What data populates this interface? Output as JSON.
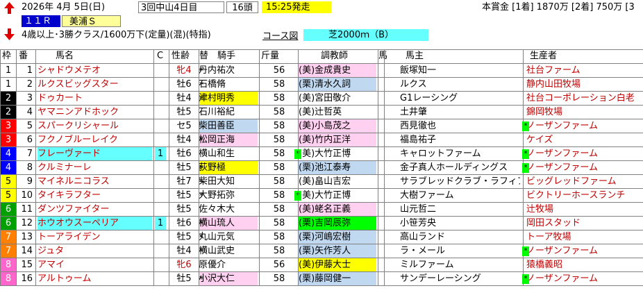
{
  "header": {
    "date_text": "2026年  4月  5日(日)",
    "meeting": "3回中山4日目",
    "runners": "16頭",
    "post_time": "15:25発走",
    "prize": "本賞金 [1着] 1870万 [2着] 750万 [3",
    "race_number": "１１Ｒ",
    "race_name": "美浦Ｓ",
    "conditions": "4歳以上･3勝クラス/1600万下(定量)(混)(特指)",
    "course_label": "コース図",
    "course": "芝2000ｍ（B）"
  },
  "columns": [
    "枠",
    "番",
    "馬名",
    "C",
    "性齢",
    "替",
    "騎手",
    "斤量",
    "調教師",
    "馬",
    "馬主",
    "生産者"
  ],
  "colors": {
    "waku": [
      "#ffffff",
      "#000000",
      "#ff0000",
      "#0000ff",
      "#ffff00",
      "#00a000",
      "#ff8000",
      "#ff66cc"
    ],
    "waku_text": [
      "#000000",
      "#ffffff",
      "#ffffff",
      "#ffffff",
      "#000000",
      "#ffffff",
      "#ffffff",
      "#ffffff"
    ],
    "highlight_pink": "#ffd0f0",
    "highlight_yellow": "#ffff00",
    "highlight_cyan": "#66ffff",
    "highlight_green": "#00ff00",
    "highlight_blue": "#c0d8f0",
    "name_color": "#c00000"
  },
  "rows": [
    {
      "waku": "1",
      "num": "1",
      "name": "シャドウメテオ",
      "c": "",
      "sex": "牝4",
      "sex_red": true,
      "sw": "*",
      "jockey": "丹内祐次",
      "jbg": "",
      "wt": "56",
      "tmark": "",
      "trainer": "(美)金成貴史",
      "tbg": "pink",
      "owner": "飯塚知一",
      "bmark": "",
      "breeder": "社台ファーム"
    },
    {
      "waku": "1",
      "num": "2",
      "name": "ルクスビッグスター",
      "c": "",
      "sex": "牡6",
      "sex_red": false,
      "sw": "*",
      "jockey": "石橋脩",
      "jbg": "",
      "wt": "58",
      "tmark": "",
      "trainer": "(栗)清水久詞",
      "tbg": "blue",
      "owner": "ルクス",
      "bmark": "",
      "breeder": "静内山田牧場"
    },
    {
      "waku": "2",
      "num": "3",
      "name": "ドゥカート",
      "c": "",
      "sex": "牡4",
      "sex_red": false,
      "sw": "*",
      "jockey": "津村明秀",
      "jbg": "yellow",
      "wt": "58",
      "tmark": "",
      "trainer": "(美)宮田敬介",
      "tbg": "",
      "owner": "G1レーシング",
      "bmark": "",
      "breeder": "社台コーポレーション白老"
    },
    {
      "waku": "2",
      "num": "4",
      "name": "ヤマニンアドホック",
      "c": "",
      "sex": "牡5",
      "sex_red": false,
      "sw": "",
      "jockey": "石川裕紀",
      "jbg": "",
      "wt": "58",
      "tmark": "",
      "trainer": "(美)辻哲英",
      "tbg": "",
      "owner": "土井肇",
      "bmark": "",
      "breeder": "錦岡牧場"
    },
    {
      "waku": "3",
      "num": "5",
      "name": "スパークリシャール",
      "c": "",
      "sex": "セ5",
      "sex_red": false,
      "sw": "",
      "jockey": "柴田善臣",
      "jbg": "blue",
      "wt": "58",
      "tmark": "",
      "trainer": "(美)小島茂之",
      "tbg": "pink",
      "owner": "西見徹也",
      "bmark": "*",
      "breeder": "ノーザンファーム"
    },
    {
      "waku": "3",
      "num": "6",
      "name": "フクノブルーレイク",
      "c": "",
      "sex": "牡4",
      "sex_red": false,
      "sw": "*",
      "jockey": "松岡正海",
      "jbg": "pink",
      "wt": "58",
      "tmark": "",
      "trainer": "(美)竹内正洋",
      "tbg": "pink",
      "owner": "福島祐子",
      "bmark": "",
      "breeder": "ケイズ"
    },
    {
      "waku": "4",
      "num": "7",
      "name": "フレーヴァード",
      "c": "1",
      "c_bg": "cyan",
      "name_bg": "cyan",
      "sex": "牡6",
      "sex_red": false,
      "sw": "",
      "jockey": "横山和生",
      "jbg": "",
      "wt": "58",
      "tmark": "*",
      "trainer": "(美)大竹正博",
      "tbg": "",
      "owner": "キャロットファーム",
      "bmark": "*",
      "breeder": "ノーザンファーム"
    },
    {
      "waku": "4",
      "num": "8",
      "name": "クルミナーレ",
      "c": "",
      "sex": "牡5",
      "sex_red": false,
      "sw": "*",
      "jockey": "荻野極",
      "jbg": "yellow",
      "wt": "58",
      "tmark": "",
      "trainer": "(栗)池江泰寿",
      "tbg": "blue",
      "owner": "金子真人ホールディングス",
      "bmark": "*",
      "breeder": "ノーザンファーム"
    },
    {
      "waku": "5",
      "num": "9",
      "name": "マイネルニコラス",
      "c": "",
      "sex": "牡7",
      "sex_red": false,
      "sw": "*",
      "jockey": "柴田大知",
      "jbg": "",
      "wt": "58",
      "tmark": "",
      "trainer": "(美)畠山吉宏",
      "tbg": "",
      "owner": "サラブレッドクラブ・ラフィアン",
      "bmark": "",
      "breeder": "ビッグレッドファーム"
    },
    {
      "waku": "5",
      "num": "10",
      "name": "タイキラフター",
      "c": "",
      "sex": "牡5",
      "sex_red": false,
      "sw": "*",
      "jockey": "大野拓弥",
      "jbg": "",
      "wt": "58",
      "tmark": "*",
      "trainer": "(美)大竹正博",
      "tbg": "",
      "owner": "大樹ファーム",
      "bmark": "",
      "breeder": "ビクトリーホースランチ"
    },
    {
      "waku": "6",
      "num": "11",
      "name": "ダンツファイター",
      "c": "",
      "sex": "牡5",
      "sex_red": false,
      "sw": "",
      "jockey": "佐々木大",
      "jbg": "",
      "wt": "58",
      "tmark": "",
      "trainer": "(美)蛯名正義",
      "tbg": "pink",
      "owner": "山元哲二",
      "bmark": "",
      "breeder": "辻牧場"
    },
    {
      "waku": "6",
      "num": "12",
      "name": "ホウオウスーペリア",
      "c": "1",
      "c_bg": "cyan",
      "name_bg": "cyan",
      "sex": "牡6",
      "sex_red": false,
      "sw": "*",
      "jockey": "横山琉人",
      "jbg": "pink",
      "wt": "58",
      "tmark": "",
      "trainer": "(栗)吉岡辰弥",
      "tbg": "green",
      "owner": "小笹芳央",
      "bmark": "",
      "breeder": "岡田スタッド"
    },
    {
      "waku": "7",
      "num": "13",
      "name": "トーアライデン",
      "c": "",
      "sex": "牡5",
      "sex_red": false,
      "sw": "*",
      "jockey": "丸山元気",
      "jbg": "",
      "wt": "58",
      "tmark": "",
      "trainer": "(栗)河嶋宏樹",
      "tbg": "blue",
      "owner": "高山ランド",
      "bmark": "",
      "breeder": "トーア牧場"
    },
    {
      "waku": "7",
      "num": "14",
      "name": "ジュタ",
      "c": "",
      "sex": "牡4",
      "sex_red": false,
      "sw": "*",
      "jockey": "横山武史",
      "jbg": "",
      "wt": "58",
      "tmark": "",
      "trainer": "(栗)矢作芳人",
      "tbg": "blue",
      "owner": "ラ・メール",
      "bmark": "*",
      "breeder": "ノーザンファーム"
    },
    {
      "waku": "8",
      "num": "15",
      "name": "アマイ",
      "c": "",
      "sex": "牝6",
      "sex_red": true,
      "sw": "",
      "jockey": "原優介",
      "jbg": "",
      "wt": "56",
      "tmark": "",
      "trainer": "(美)伊藤大士",
      "tbg": "yellow",
      "owner": "ミルファーム",
      "bmark": "",
      "breeder": "猿橋義昭"
    },
    {
      "waku": "8",
      "num": "16",
      "name": "アルトゥーム",
      "c": "",
      "sex": "牡5",
      "sex_red": false,
      "sw": "*",
      "jockey": "小沢大仁",
      "jbg": "pink",
      "wt": "58",
      "tmark": "",
      "trainer": "(栗)藤岡健一",
      "tbg": "blue",
      "owner": "サンデーレーシング",
      "bmark": "*",
      "breeder": "ノーザンファーム"
    }
  ]
}
